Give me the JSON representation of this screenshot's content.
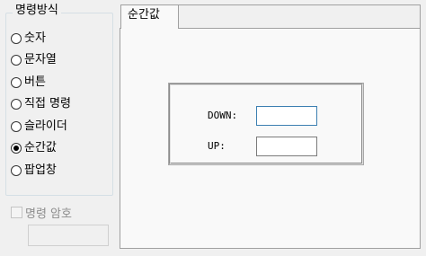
{
  "group": {
    "title": "명령방식",
    "options": [
      {
        "label": "숫자",
        "checked": false
      },
      {
        "label": "문자열",
        "checked": false
      },
      {
        "label": "버튼",
        "checked": false
      },
      {
        "label": "직접 명령",
        "checked": false
      },
      {
        "label": "슬라이더",
        "checked": false
      },
      {
        "label": "순간값",
        "checked": true
      },
      {
        "label": "팝업창",
        "checked": false
      }
    ]
  },
  "password": {
    "label": "명령 암호",
    "checked": false,
    "value": ""
  },
  "tabs": [
    {
      "label": "순간값",
      "active": true
    }
  ],
  "fields": {
    "down": {
      "label": "DOWN:",
      "value": ""
    },
    "up": {
      "label": "UP:",
      "value": ""
    }
  }
}
